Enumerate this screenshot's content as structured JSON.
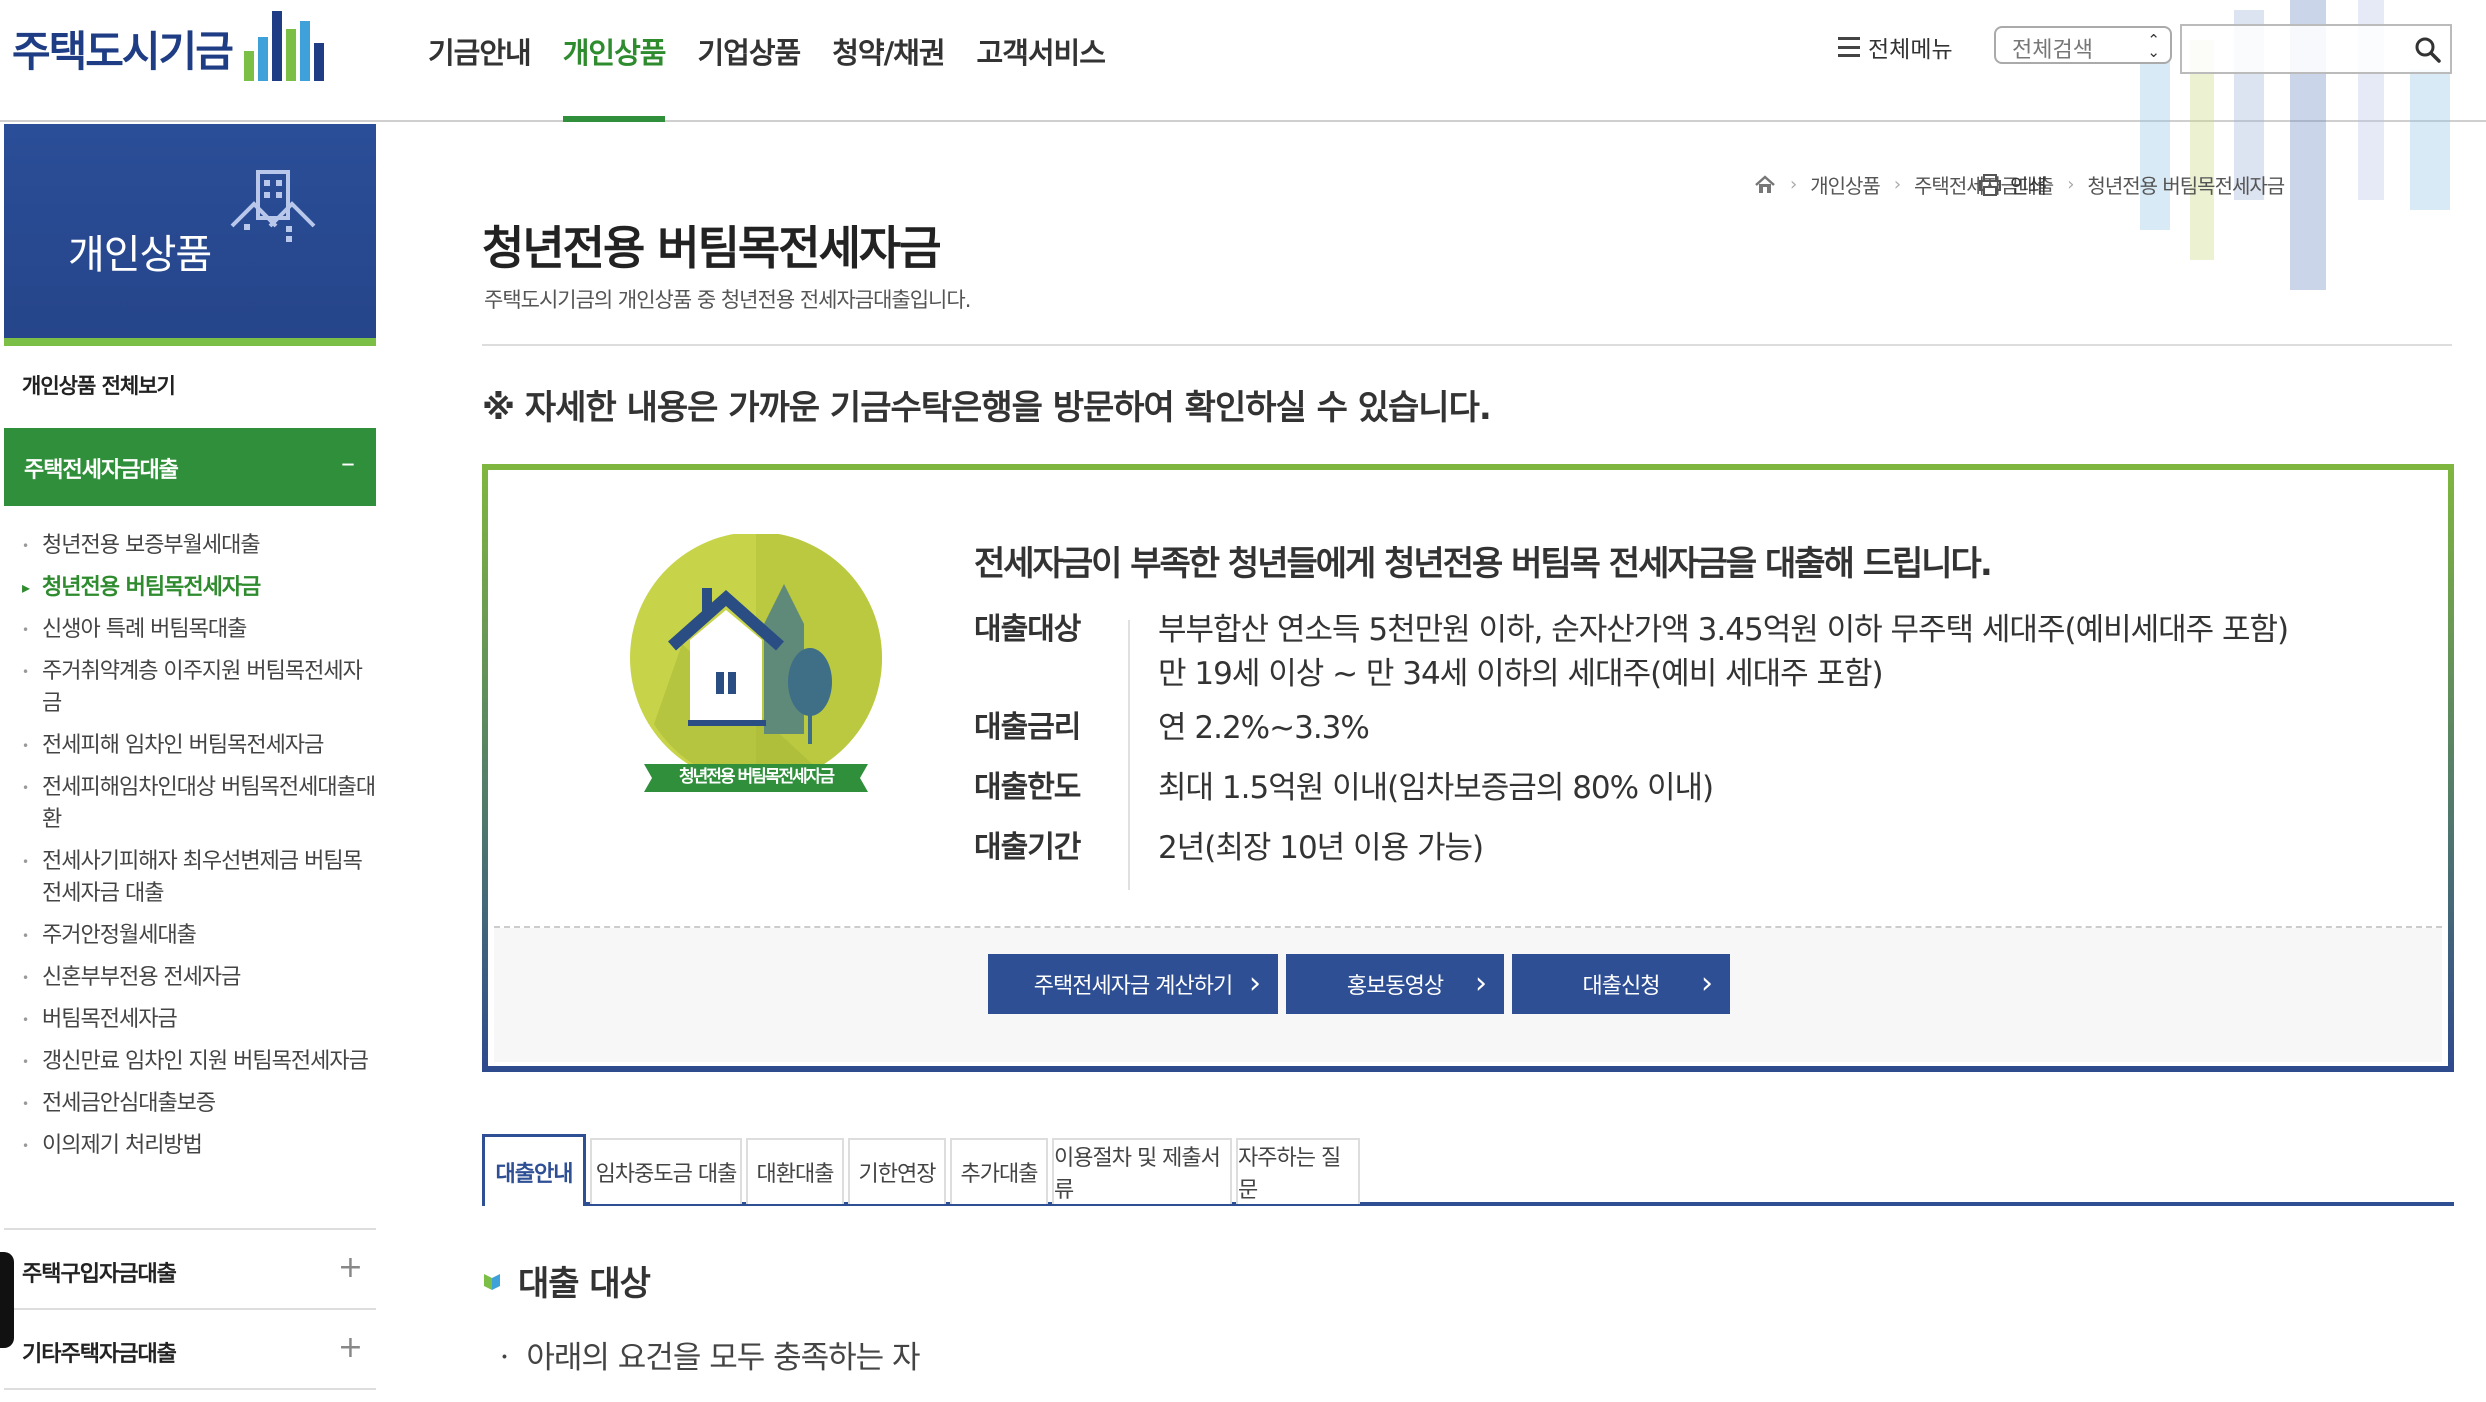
{
  "header": {
    "logo_text": "주택도시기금",
    "gnb": [
      "기금안내",
      "개인상품",
      "기업상품",
      "청약/채권",
      "고객서비스"
    ],
    "all_menu": "전체메뉴",
    "search_select": "전체검색",
    "search_value": ""
  },
  "lnb": {
    "banner_title": "개인상품",
    "all_link": "개인상품 전체보기",
    "open_group": "주택전세자금대출",
    "open_toggle": "–",
    "sub_items": [
      "청년전용 보증부월세대출",
      "청년전용 버팀목전세자금",
      "신생아 특례 버팀목대출",
      "주거취약계층 이주지원 버팀목전세자금",
      "전세피해 임차인 버팀목전세자금",
      "전세피해임차인대상 버팀목전세대출대환",
      "전세사기피해자 최우선변제금 버팀목 전세자금 대출",
      "주거안정월세대출",
      "신혼부부전용 전세자금",
      "버팀목전세자금",
      "갱신만료 임차인 지원 버팀목전세자금",
      "전세금안심대출보증",
      "이의제기 처리방법"
    ],
    "closed_groups": [
      "주택구입자금대출",
      "기타주택자금대출"
    ],
    "closed_toggle": "+"
  },
  "breadcrumb": [
    "개인상품",
    "주택전세자금대출",
    "청년전용 버팀목전세자금"
  ],
  "print_label": "인쇄",
  "page": {
    "title": "청년전용 버팀목전세자금",
    "desc": "주택도시기금의 개인상품 중 청년전용 전세자금대출입니다.",
    "notice": "※ 자세한 내용은 가까운 기금수탁은행을 방문하여 확인하실 수 있습니다."
  },
  "card": {
    "badge_label": "청년전용 버팀목전세자금",
    "headline": "전세자금이 부족한 청년들에게 청년전용 버팀목 전세자금을 대출해 드립니다.",
    "rows": [
      {
        "label": "대출대상",
        "lines": [
          "부부합산 연소득 5천만원 이하, 순자산가액 3.45억원 이하 무주택 세대주(예비세대주 포함)",
          "만 19세 이상 ~ 만 34세 이하의 세대주(예비 세대주 포함)"
        ]
      },
      {
        "label": "대출금리",
        "lines": [
          "연 2.2%~3.3%"
        ]
      },
      {
        "label": "대출한도",
        "lines": [
          "최대 1.5억원 이내(임차보증금의 80% 이내)"
        ]
      },
      {
        "label": "대출기간",
        "lines": [
          "2년(최장 10년 이용 가능)"
        ]
      }
    ],
    "buttons": [
      "주택전세자금 계산하기",
      "홍보동영상",
      "대출신청"
    ]
  },
  "tabs": [
    "대출안내",
    "임차중도금 대출",
    "대환대출",
    "기한연장",
    "추가대출",
    "이용절차 및 제출서류",
    "자주하는 질문"
  ],
  "section": {
    "title": "대출 대상",
    "item": "ㆍ 아래의 요건을 모두 충족하는 자"
  },
  "colors": {
    "brand_navy": "#2f4f95",
    "brand_green": "#2f8f3a",
    "accent_lime": "#7fb63f"
  }
}
